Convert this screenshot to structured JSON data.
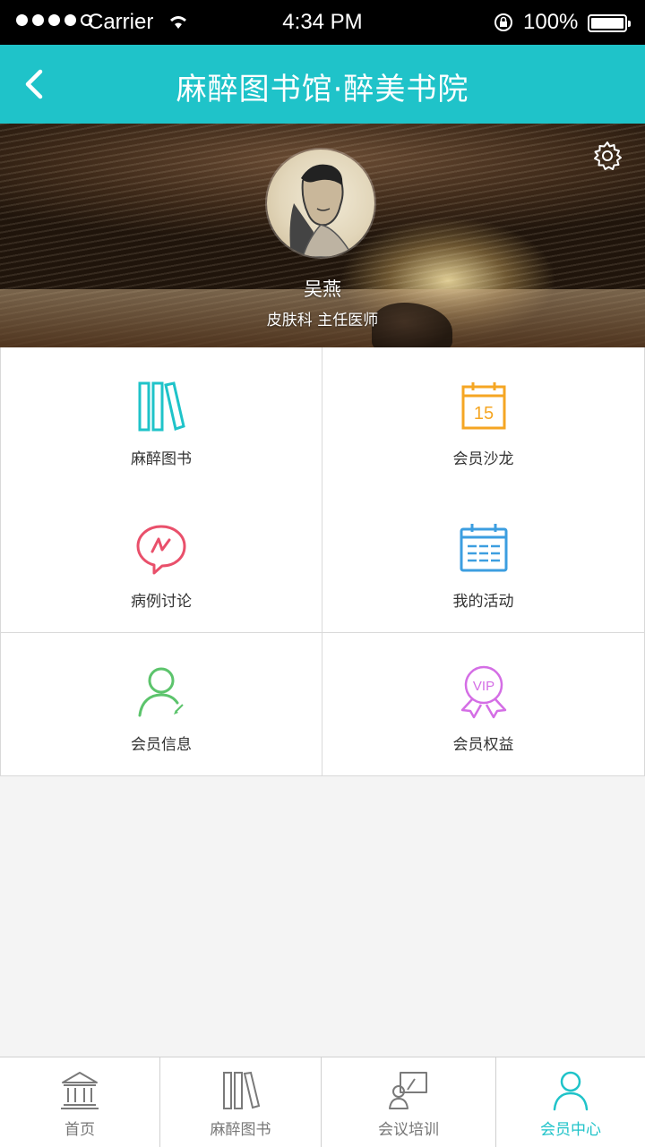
{
  "status_bar": {
    "carrier": "Carrier",
    "time": "4:34 PM",
    "battery": "100%"
  },
  "nav": {
    "title": "麻醉图书馆·醉美书院",
    "back_icon": "chevron-left-icon",
    "background": "#1fc3c9"
  },
  "profile": {
    "name": "吴燕",
    "title": "皮肤科  主任医师",
    "settings_icon": "gear-icon"
  },
  "menu": [
    {
      "label": "麻醉图书",
      "icon": "books-icon",
      "color": "#1fc3c9"
    },
    {
      "label": "会员沙龙",
      "icon": "calendar-15-icon",
      "icon_text": "15",
      "color": "#f5a623"
    },
    {
      "label": "病例讨论",
      "icon": "chat-bubble-icon",
      "color": "#e9506b"
    },
    {
      "label": "我的活动",
      "icon": "calendar-icon",
      "color": "#3c9ee0"
    },
    {
      "label": "会员信息",
      "icon": "user-edit-icon",
      "color": "#5cc46c"
    },
    {
      "label": "会员权益",
      "icon": "vip-badge-icon",
      "icon_text": "VIP",
      "color": "#d46ee5"
    }
  ],
  "tabs": [
    {
      "label": "首页",
      "icon": "bank-icon",
      "active": false
    },
    {
      "label": "麻醉图书",
      "icon": "books-icon",
      "active": false
    },
    {
      "label": "会议培训",
      "icon": "meeting-icon",
      "active": false
    },
    {
      "label": "会员中心",
      "icon": "user-icon",
      "active": true
    }
  ],
  "accent": "#1fc3c9"
}
